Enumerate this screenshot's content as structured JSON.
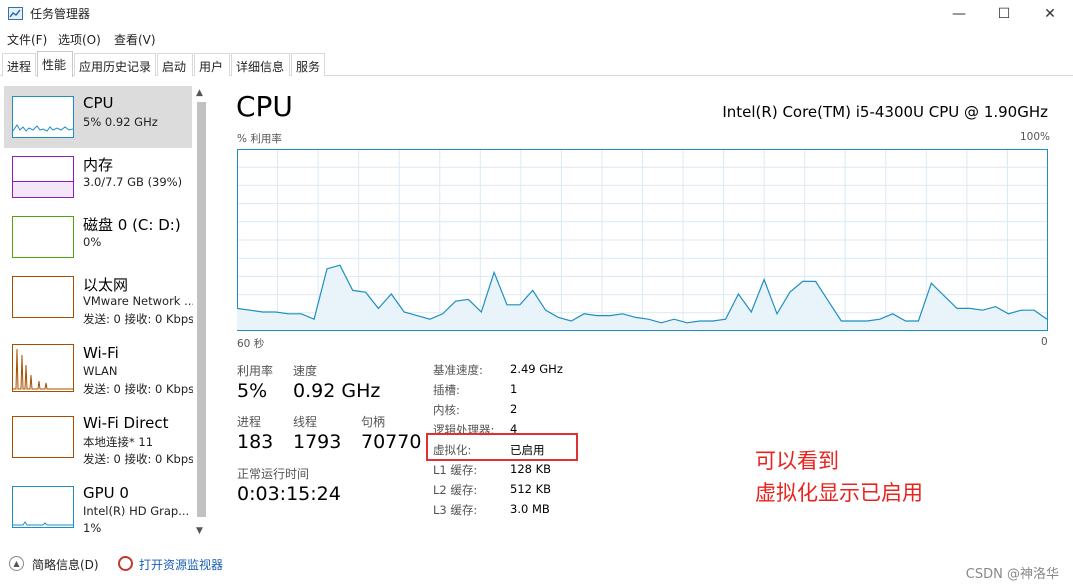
{
  "window": {
    "title": "任务管理器",
    "min": "—",
    "max": "☐",
    "close": "✕"
  },
  "menu": [
    "文件(F)",
    "选项(O)",
    "查看(V)"
  ],
  "tabs": [
    "进程",
    "性能",
    "应用历史记录",
    "启动",
    "用户",
    "详细信息",
    "服务"
  ],
  "sidebar": [
    {
      "title": "CPU",
      "sub1": "5% 0.92 GHz",
      "sub2": ""
    },
    {
      "title": "内存",
      "sub1": "3.0/7.7 GB (39%)",
      "sub2": ""
    },
    {
      "title": "磁盘 0 (C: D:)",
      "sub1": "0%",
      "sub2": ""
    },
    {
      "title": "以太网",
      "sub1": "VMware Network ...",
      "sub2": "发送: 0 接收: 0 Kbps"
    },
    {
      "title": "Wi-Fi",
      "sub1": "WLAN",
      "sub2": "发送: 0 接收: 0 Kbps"
    },
    {
      "title": "Wi-Fi Direct",
      "sub1": "本地连接* 11",
      "sub2": "发送: 0 接收: 0 Kbps"
    },
    {
      "title": "GPU 0",
      "sub1": "Intel(R) HD Grap...",
      "sub2": "1%"
    }
  ],
  "main": {
    "title": "CPU",
    "model": "Intel(R) Core(TM) i5-4300U CPU @ 1.90GHz",
    "util_label": "% 利用率",
    "max_label": "100%",
    "time_left": "60 秒",
    "time_right": "0"
  },
  "chart_data": {
    "type": "area",
    "ylim": [
      0,
      100
    ],
    "xlabel_left": "60 秒",
    "xlabel_right": "0",
    "values": [
      12,
      11,
      10,
      10,
      9,
      9,
      6,
      34,
      36,
      22,
      21,
      12,
      20,
      10,
      8,
      6,
      9,
      16,
      17,
      10,
      32,
      14,
      14,
      22,
      11,
      7,
      5,
      9,
      8,
      8,
      9,
      7,
      6,
      4,
      6,
      4,
      5,
      5,
      6,
      20,
      10,
      28,
      9,
      21,
      27,
      27,
      16,
      5,
      5,
      5,
      6,
      9,
      5,
      5,
      26,
      19,
      12,
      12,
      11,
      13,
      9,
      11,
      11,
      6
    ]
  },
  "stats": {
    "util_label": "利用率",
    "util_value": "5%",
    "speed_label": "速度",
    "speed_value": "0.92 GHz",
    "proc_label": "进程",
    "proc_value": "183",
    "thread_label": "线程",
    "thread_value": "1793",
    "handle_label": "句柄",
    "handle_value": "70770",
    "uptime_label": "正常运行时间",
    "uptime_value": "0:03:15:24"
  },
  "details": [
    {
      "label": "基准速度:",
      "value": "2.49 GHz"
    },
    {
      "label": "插槽:",
      "value": "1"
    },
    {
      "label": "内核:",
      "value": "2"
    },
    {
      "label": "逻辑处理器:",
      "value": "4"
    },
    {
      "label": "虚拟化:",
      "value": "已启用"
    },
    {
      "label": "L1 缓存:",
      "value": "128 KB"
    },
    {
      "label": "L2 缓存:",
      "value": "512 KB"
    },
    {
      "label": "L3 缓存:",
      "value": "3.0 MB"
    }
  ],
  "annotation": {
    "line1": "可以看到",
    "line2": "虚拟化显示已启用"
  },
  "footer": {
    "brief": "简略信息(D)",
    "monitor": "打开资源监视器"
  },
  "watermark": "CSDN @神洛华",
  "colors": {
    "cpu": "#1f8fc1",
    "memory": "#8b1fb5",
    "disk": "#4da60c",
    "network": "#a74f01",
    "annotation": "#e8231e"
  }
}
